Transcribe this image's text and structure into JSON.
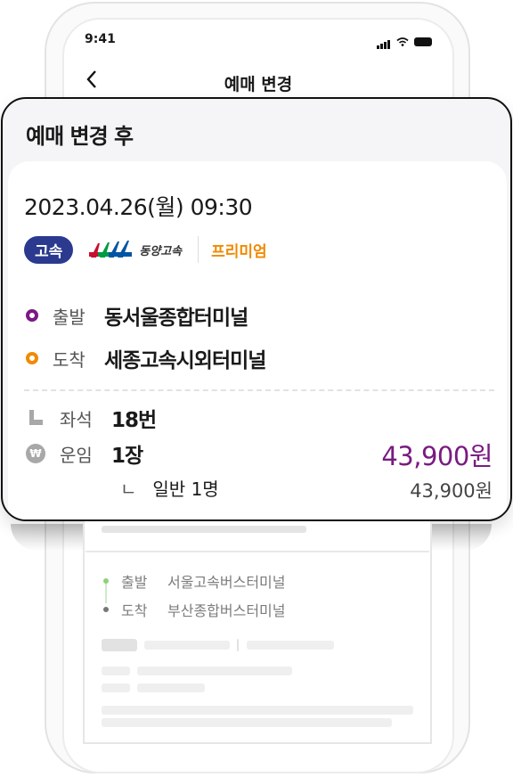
{
  "status_bar": {
    "time": "9:41"
  },
  "header": {
    "title": "예매 변경"
  },
  "card": {
    "title": "예매 변경 후",
    "date": "2023.04.26(월) 09:30",
    "badge": "고속",
    "operator_logo_text": "동양고속",
    "grade": "프리미엄",
    "departure_label": "출발",
    "departure_value": "동서울종합터미널",
    "arrival_label": "도착",
    "arrival_value": "세종고속시외터미널",
    "seat_label": "좌석",
    "seat_value": "18번",
    "fare_label": "운임",
    "fare_value": "1장",
    "fare_total": "43,900원",
    "sub_corner": "ㄴ",
    "sub_label": "일반 1명",
    "sub_price": "43,900원"
  },
  "background_ticket": {
    "departure_label": "출발",
    "departure_value": "서울고속버스터미널",
    "arrival_label": "도착",
    "arrival_value": "부산종합버스터미널"
  },
  "colors": {
    "brand_badge": "#2b3a8f",
    "accent_purple": "#7a1a82",
    "premium_orange": "#f08a00"
  }
}
